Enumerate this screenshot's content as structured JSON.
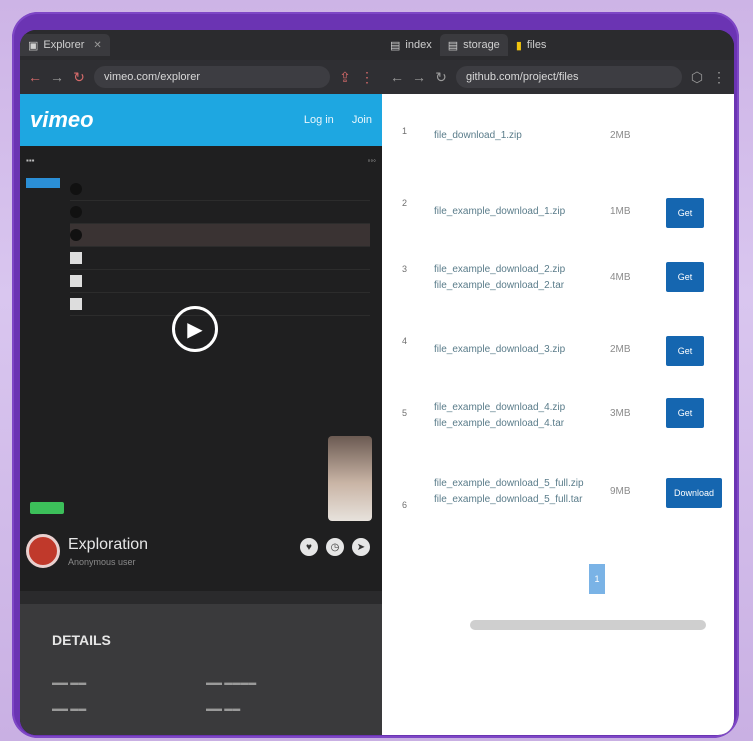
{
  "left_window": {
    "tabs": [
      {
        "label": "Explorer"
      }
    ],
    "address": "vimeo.com/explorer",
    "vimeo": {
      "logo": "vimeo",
      "nav": [
        "Log in",
        "Join"
      ]
    },
    "video": {
      "title": "Exploration",
      "subtitle": "Anonymous user",
      "details_title": "DETAILS"
    }
  },
  "right_window": {
    "tabs": [
      {
        "label": "index"
      },
      {
        "label": "storage"
      },
      {
        "label": "files"
      }
    ],
    "address": "github.com/project/files",
    "rows": [
      {
        "idx": "1",
        "name": "file_download_1.zip",
        "size": "2MB",
        "button": ""
      },
      {
        "idx": "2",
        "name": "file_example_download_1.zip",
        "size": "1MB",
        "button": "Get"
      },
      {
        "idx": "3",
        "name": "file_example_download_2.zip\nfile_example_download_2.tar",
        "size": "4MB",
        "button": "Get"
      },
      {
        "idx": "4",
        "name": "file_example_download_3.zip",
        "size": "2MB",
        "button": "Get"
      },
      {
        "idx": "5",
        "name": "file_example_download_4.zip\nfile_example_download_4.tar",
        "size": "3MB",
        "button": "Get"
      },
      {
        "idx": "6",
        "name": "file_example_download_5_full.zip\nfile_example_download_5_full.tar",
        "size": "9MB",
        "button": "Download"
      }
    ],
    "pager_label": "1"
  }
}
